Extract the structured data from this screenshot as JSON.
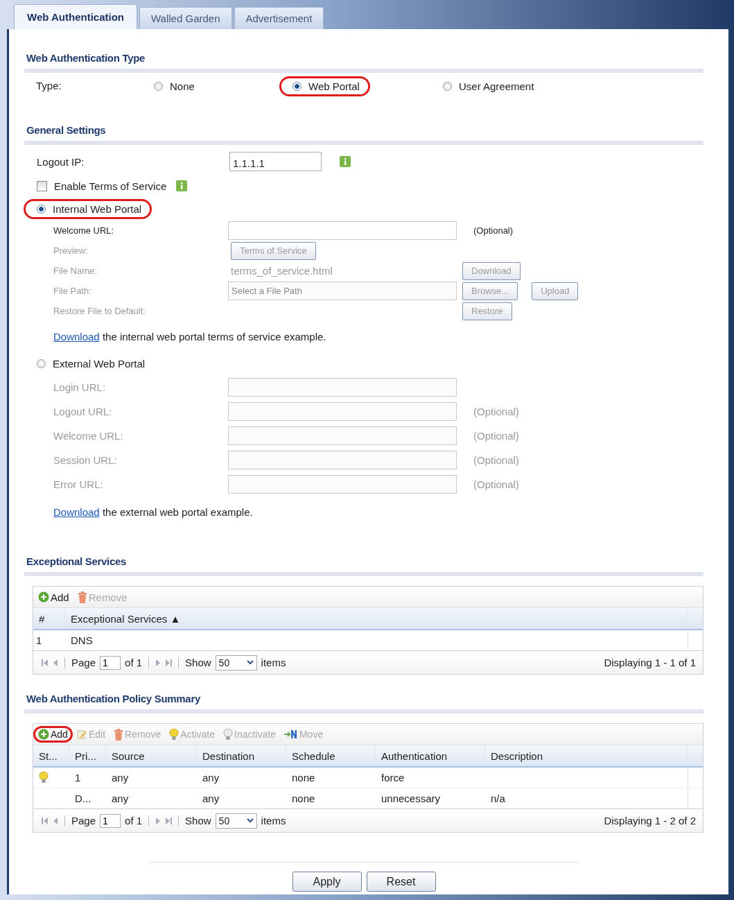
{
  "tabs": [
    {
      "label": "Web Authentication",
      "selected": true
    },
    {
      "label": "Walled Garden",
      "selected": false
    },
    {
      "label": "Advertisement",
      "selected": false
    }
  ],
  "auth_type": {
    "title": "Web Authentication Type",
    "label": "Type:",
    "options": [
      {
        "label": "None",
        "selected": false,
        "highlighted": false
      },
      {
        "label": "Web Portal",
        "selected": true,
        "highlighted": true
      },
      {
        "label": "User Agreement",
        "selected": false,
        "highlighted": false
      }
    ]
  },
  "general": {
    "title": "General Settings",
    "logout_ip": {
      "label": "Logout IP:",
      "value": "1.1.1.1"
    },
    "terms": {
      "label": "Enable Terms of Service",
      "checked": false
    },
    "internal": {
      "label": "Internal Web Portal",
      "selected": true,
      "highlighted": true,
      "rows": [
        {
          "label": "Welcome URL:",
          "disabled": false,
          "main": {
            "kind": "input"
          },
          "extras": [
            {
              "kind": "note",
              "text": "(Optional)"
            }
          ]
        },
        {
          "label": "Preview:",
          "disabled": true,
          "main": {
            "kind": "button",
            "text": "Terms of Service"
          },
          "extras": []
        },
        {
          "label": "File Name:",
          "disabled": true,
          "main": {
            "kind": "text",
            "text": "terms_of_service.html"
          },
          "extras": [
            {
              "kind": "button",
              "text": "Download"
            }
          ]
        },
        {
          "label": "File Path:",
          "disabled": true,
          "main": {
            "kind": "input",
            "placeholder": "Select a File Path"
          },
          "extras": [
            {
              "kind": "button",
              "text": "Browse..."
            },
            {
              "kind": "button",
              "text": "Upload"
            }
          ]
        },
        {
          "label": "Restore File to Default:",
          "disabled": true,
          "main": {
            "kind": "none"
          },
          "extras": [
            {
              "kind": "button",
              "text": "Restore"
            }
          ]
        }
      ],
      "link": {
        "link": "Download",
        "text": "the internal web portal terms of service example."
      }
    },
    "external": {
      "label": "External Web Portal",
      "selected": false,
      "highlighted": false,
      "rows": [
        {
          "label": "Login URL:",
          "disabled": true,
          "main": {
            "kind": "input"
          },
          "extras": []
        },
        {
          "label": "Logout URL:",
          "disabled": true,
          "main": {
            "kind": "input"
          },
          "extras": [
            {
              "kind": "note",
              "text": "(Optional)"
            }
          ]
        },
        {
          "label": "Welcome URL:",
          "disabled": true,
          "main": {
            "kind": "input"
          },
          "extras": [
            {
              "kind": "note",
              "text": "(Optional)"
            }
          ]
        },
        {
          "label": "Session URL:",
          "disabled": true,
          "main": {
            "kind": "input"
          },
          "extras": [
            {
              "kind": "note",
              "text": "(Optional)"
            }
          ]
        },
        {
          "label": "Error URL:",
          "disabled": true,
          "main": {
            "kind": "input"
          },
          "extras": [
            {
              "kind": "note",
              "text": "(Optional)"
            }
          ]
        }
      ],
      "link": {
        "link": "Download",
        "text": "the external web portal example."
      }
    }
  },
  "exceptional": {
    "title": "Exceptional Services",
    "toolbar": [
      {
        "label": "Add",
        "kind": "add",
        "disabled": false,
        "highlighted": false
      },
      {
        "label": "Remove",
        "kind": "remove",
        "disabled": true,
        "highlighted": false
      }
    ],
    "columns": [
      "#",
      "Exceptional Services ▲"
    ],
    "rows": [
      {
        "cells": [
          "1",
          "DNS"
        ]
      }
    ],
    "pager": {
      "page_label": "Page",
      "page": "1",
      "of": "of 1",
      "show_label": "Show",
      "show": "50",
      "items": "items",
      "display": "Displaying 1 - 1 of 1"
    }
  },
  "policy": {
    "title": "Web Authentication Policy Summary",
    "toolbar": [
      {
        "label": "Add",
        "kind": "add",
        "disabled": false,
        "highlighted": true
      },
      {
        "label": "Edit",
        "kind": "edit",
        "disabled": true,
        "highlighted": false
      },
      {
        "label": "Remove",
        "kind": "remove",
        "disabled": true,
        "highlighted": false
      },
      {
        "label": "Activate",
        "kind": "activate",
        "disabled": true,
        "highlighted": false
      },
      {
        "label": "Inactivate",
        "kind": "inactivate",
        "disabled": true,
        "highlighted": false
      },
      {
        "label": "Move",
        "kind": "move",
        "disabled": true,
        "highlighted": false
      }
    ],
    "columns": [
      "St...",
      "Pri...",
      "Source",
      "Destination",
      "Schedule",
      "Authentication",
      "Description"
    ],
    "rows": [
      {
        "bulb": true,
        "cells": [
          "",
          "1",
          "any",
          "any",
          "none",
          "force",
          ""
        ]
      },
      {
        "bulb": false,
        "cells": [
          "",
          "D...",
          "any",
          "any",
          "none",
          "unnecessary",
          "n/a"
        ]
      }
    ],
    "pager": {
      "page_label": "Page",
      "page": "1",
      "of": "of 1",
      "show_label": "Show",
      "show": "50",
      "items": "items",
      "display": "Displaying 1 - 2 of 2"
    }
  },
  "buttons": [
    "Apply",
    "Reset"
  ]
}
